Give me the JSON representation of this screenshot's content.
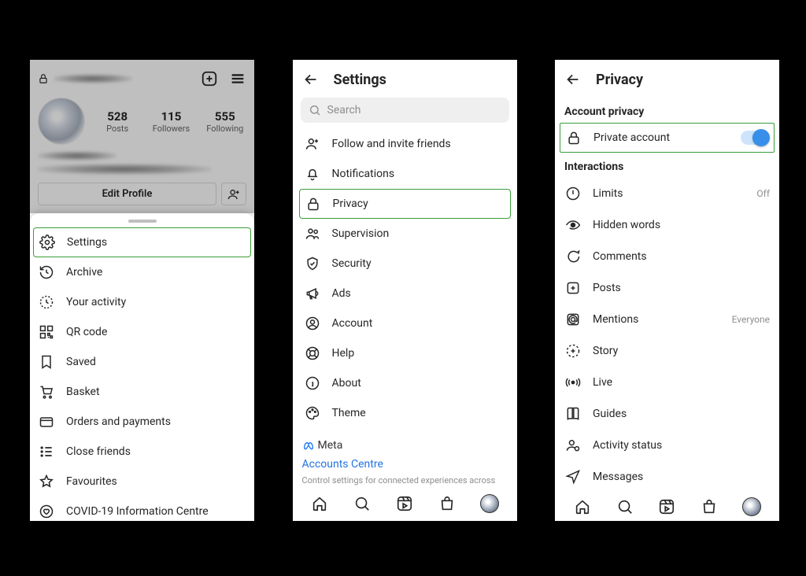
{
  "panel1": {
    "stats": {
      "posts": {
        "num": "528",
        "label": "Posts"
      },
      "followers": {
        "num": "115",
        "label": "Followers"
      },
      "following": {
        "num": "555",
        "label": "Following"
      }
    },
    "edit_profile": "Edit Profile",
    "menu": {
      "settings": "Settings",
      "archive": "Archive",
      "activity": "Your activity",
      "qr": "QR code",
      "saved": "Saved",
      "basket": "Basket",
      "orders": "Orders and payments",
      "close_friends": "Close friends",
      "favourites": "Favourites",
      "covid": "COVID-19 Information Centre"
    }
  },
  "panel2": {
    "title": "Settings",
    "search_placeholder": "Search",
    "items": {
      "follow": "Follow and invite friends",
      "notifications": "Notifications",
      "privacy": "Privacy",
      "supervision": "Supervision",
      "security": "Security",
      "ads": "Ads",
      "account": "Account",
      "help": "Help",
      "about": "About",
      "theme": "Theme"
    },
    "meta_brand": "Meta",
    "accounts_centre": "Accounts Centre",
    "meta_desc": "Control settings for connected experiences across"
  },
  "panel3": {
    "title": "Privacy",
    "section_account": "Account privacy",
    "private_account": "Private account",
    "section_interactions": "Interactions",
    "rows": {
      "limits": {
        "label": "Limits",
        "value": "Off"
      },
      "hidden": {
        "label": "Hidden words"
      },
      "comments": {
        "label": "Comments"
      },
      "posts": {
        "label": "Posts"
      },
      "mentions": {
        "label": "Mentions",
        "value": "Everyone"
      },
      "story": {
        "label": "Story"
      },
      "live": {
        "label": "Live"
      },
      "guides": {
        "label": "Guides"
      },
      "activity": {
        "label": "Activity status"
      },
      "messages": {
        "label": "Messages"
      }
    }
  }
}
